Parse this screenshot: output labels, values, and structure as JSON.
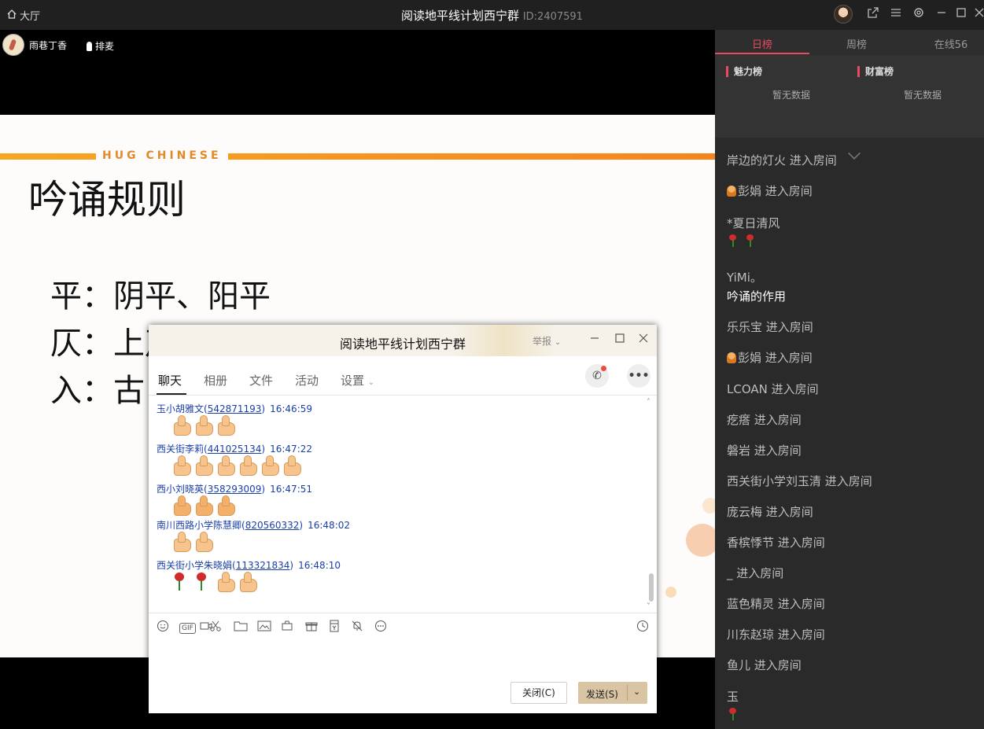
{
  "topbar": {
    "lobby_label": "大厅",
    "room_title": "阅读地平线计划西宁群",
    "room_id": "ID:2407591"
  },
  "stage": {
    "host_name": "雨巷丁香",
    "mic_queue_label": "排麦",
    "slide": {
      "brand": "HUG CHINESE",
      "title": "吟诵规则",
      "lines": [
        "平：阴平、阳平",
        "仄：上声、去声",
        "入：古"
      ]
    }
  },
  "rank": {
    "tabs": [
      "日榜",
      "周榜",
      "在线56"
    ],
    "active_tab": "日榜",
    "charm_label": "魅力榜",
    "wealth_label": "财富榜",
    "charm_empty": "暂无数据",
    "wealth_empty": "暂无数据"
  },
  "feed": [
    {
      "text": "岸边的灯火 进入房间",
      "style": "normal"
    },
    {
      "text": "彭娟 进入房间",
      "style": "tag"
    },
    {
      "text": "*夏日清风",
      "style": "normal"
    },
    {
      "text": "",
      "style": "roses",
      "roses": 2
    },
    {
      "text": "YiMi。",
      "style": "normal"
    },
    {
      "text": "吟诵的作用",
      "style": "white"
    },
    {
      "text": "乐乐宝 进入房间",
      "style": "normal"
    },
    {
      "text": "彭娟 进入房间",
      "style": "tag"
    },
    {
      "text": "LCOAN 进入房间",
      "style": "normal"
    },
    {
      "text": "疙瘩 进入房间",
      "style": "normal"
    },
    {
      "text": "磐岩 进入房间",
      "style": "normal"
    },
    {
      "text": "西关街小学刘玉清 进入房间",
      "style": "normal"
    },
    {
      "text": "庞云梅 进入房间",
      "style": "normal"
    },
    {
      "text": "香槟悸节 进入房间",
      "style": "normal"
    },
    {
      "text": "_ 进入房间",
      "style": "normal"
    },
    {
      "text": "蓝色精灵 进入房间",
      "style": "normal"
    },
    {
      "text": "川东赵琼 进入房间",
      "style": "normal"
    },
    {
      "text": "鱼儿 进入房间",
      "style": "normal"
    },
    {
      "text": "玉",
      "style": "normal"
    },
    {
      "text": "",
      "style": "roses",
      "roses": 1
    }
  ],
  "chat": {
    "title": "阅读地平线计划西宁群",
    "report_label": "举报",
    "tabs": [
      "聊天",
      "相册",
      "文件",
      "活动",
      "设置"
    ],
    "messages": [
      {
        "sender": "玉小胡雅文",
        "qq": "542871193",
        "time": "16:46:59",
        "thumbs": 3,
        "roses": 0
      },
      {
        "sender": "西关街李莉",
        "qq": "441025134",
        "time": "16:47:22",
        "thumbs": 6,
        "roses": 0
      },
      {
        "sender": "西小刘晓英",
        "qq": "358293009",
        "time": "16:47:51",
        "thumbs": 3,
        "roses": 0
      },
      {
        "sender": "南川西路小学陈慧卿",
        "qq": "820560332",
        "time": "16:48:02",
        "thumbs": 2,
        "roses": 0
      },
      {
        "sender": "西关街小学朱晓娟",
        "qq": "113321834",
        "time": "16:48:10",
        "thumbs": 2,
        "roses": 2
      }
    ],
    "close_button": "关闭(C)",
    "send_button": "发送(S)"
  },
  "icons": {
    "home": "home-icon",
    "share": "share-icon",
    "menu": "menu-icon",
    "settings": "gear-icon",
    "maximize": "maximize-icon",
    "close": "close-icon"
  },
  "colors": {
    "accent_red": "#e84a5f",
    "send_button": "#d9c4a4",
    "link_blue": "#1a3fa8",
    "slide_band": "#f6841e"
  }
}
